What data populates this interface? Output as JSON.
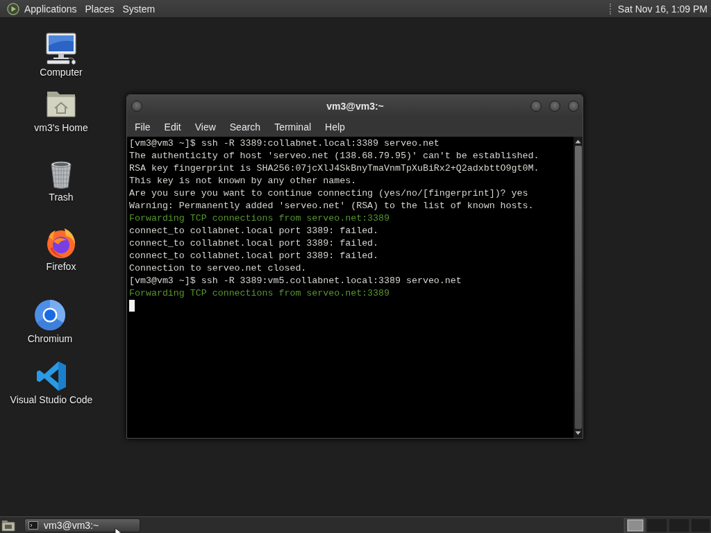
{
  "top_panel": {
    "menus": [
      "Applications",
      "Places",
      "System"
    ],
    "clock": "Sat Nov 16, 1:09 PM"
  },
  "desktop_icons": [
    {
      "label": "Computer",
      "kind": "computer"
    },
    {
      "label": "vm3's Home",
      "kind": "home"
    },
    {
      "label": "Trash",
      "kind": "trash"
    },
    {
      "label": "Firefox",
      "kind": "firefox"
    },
    {
      "label": "Chromium",
      "kind": "chromium"
    },
    {
      "label": "Visual Studio Code",
      "kind": "vscode"
    }
  ],
  "terminal": {
    "title": "vm3@vm3:~",
    "menu": [
      "File",
      "Edit",
      "View",
      "Search",
      "Terminal",
      "Help"
    ],
    "lines": [
      {
        "text": "[vm3@vm3 ~]$ ssh -R 3389:collabnet.local:3389 serveo.net",
        "kind": "output"
      },
      {
        "text": "The authenticity of host 'serveo.net (138.68.79.95)' can't be established.",
        "kind": "output"
      },
      {
        "text": "RSA key fingerprint is SHA256:07jcXlJ4SkBnyTmaVnmTpXuBiRx2+Q2adxbttO9gt0M.",
        "kind": "output"
      },
      {
        "text": "This key is not known by any other names.",
        "kind": "output"
      },
      {
        "text": "Are you sure you want to continue connecting (yes/no/[fingerprint])? yes",
        "kind": "output"
      },
      {
        "text": "Warning: Permanently added 'serveo.net' (RSA) to the list of known hosts.",
        "kind": "output"
      },
      {
        "text": "Forwarding TCP connections from serveo.net:3389",
        "kind": "notice"
      },
      {
        "text": "connect_to collabnet.local port 3389: failed.",
        "kind": "output"
      },
      {
        "text": "connect_to collabnet.local port 3389: failed.",
        "kind": "output"
      },
      {
        "text": "connect_to collabnet.local port 3389: failed.",
        "kind": "output"
      },
      {
        "text": "Connection to serveo.net closed.",
        "kind": "output"
      },
      {
        "text": "[vm3@vm3 ~]$ ssh -R 3389:vm5.collabnet.local:3389 serveo.net",
        "kind": "output"
      },
      {
        "text": "Forwarding TCP connections from serveo.net:3389",
        "kind": "notice"
      }
    ]
  },
  "bottom_panel": {
    "tasks": [
      {
        "label": "vm3@vm3:~"
      }
    ]
  }
}
